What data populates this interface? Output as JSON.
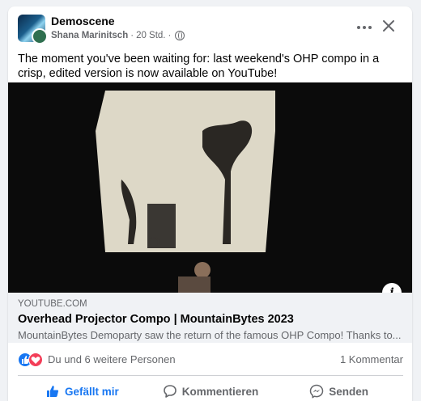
{
  "post": {
    "group_name": "Demoscene",
    "author": "Shana Marinitsch",
    "time": "20 Std.",
    "separator": "·",
    "text": "The moment you've been waiting for: last weekend's OHP compo in a crisp, edited version is now available on YouTube!"
  },
  "link": {
    "domain": "YOUTUBE.COM",
    "title": "Overhead Projector Compo | MountainBytes 2023",
    "description": "MountainBytes Demoparty saw the return of the famous OHP Compo! Thanks to..."
  },
  "reactions": {
    "text": "Du und 6 weitere Personen",
    "comments": "1 Kommentar"
  },
  "actions": {
    "like": "Gefällt mir",
    "comment": "Kommentieren",
    "share": "Senden"
  },
  "icons": {
    "more": "more-icon",
    "close": "close-icon",
    "info": "info-icon",
    "globe": "globe-icon"
  },
  "colors": {
    "accent": "#1877f2",
    "love": "#f33e58",
    "muted": "#65676b"
  }
}
